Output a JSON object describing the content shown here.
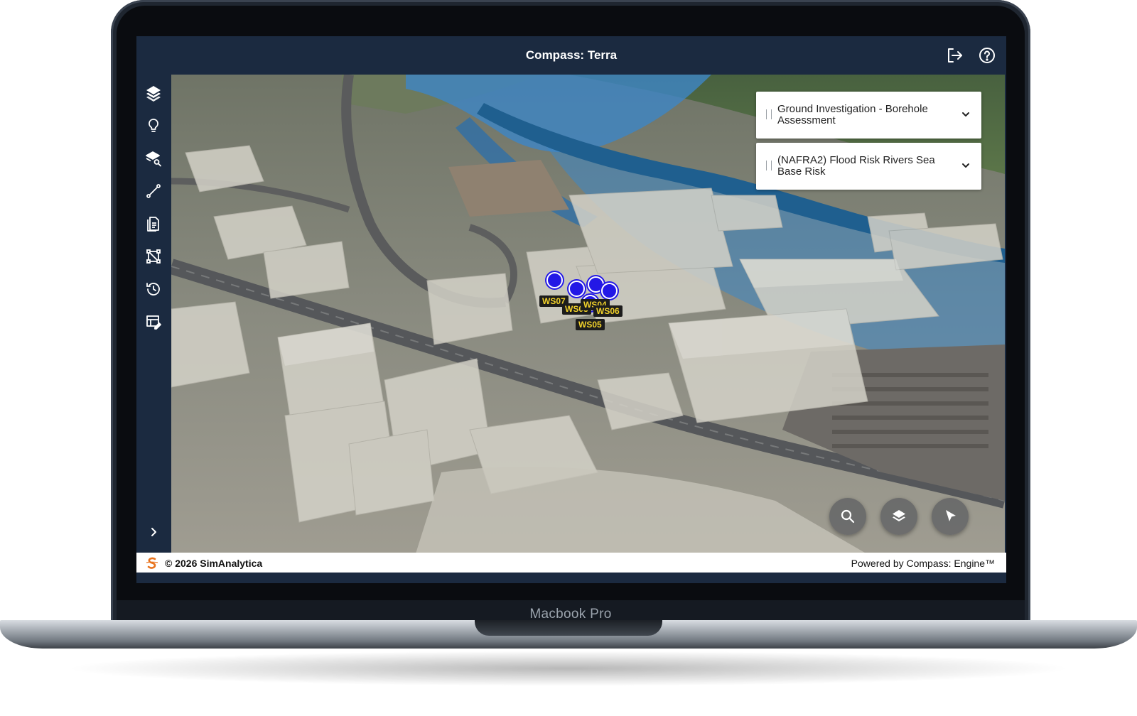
{
  "app": {
    "title": "Compass: Terra",
    "header_icons": [
      "logout-icon",
      "help-icon"
    ]
  },
  "sidebar": {
    "items": [
      {
        "name": "layers",
        "icon": "layers-icon"
      },
      {
        "name": "insights",
        "icon": "lightbulb-icon"
      },
      {
        "name": "layer-search",
        "icon": "layer-search-icon"
      },
      {
        "name": "measure",
        "icon": "measure-line-icon"
      },
      {
        "name": "reports",
        "icon": "document-icon"
      },
      {
        "name": "network",
        "icon": "network-icon"
      },
      {
        "name": "history",
        "icon": "history-icon"
      },
      {
        "name": "form-edit",
        "icon": "form-edit-icon"
      }
    ],
    "expand_icon": "chevron-right-icon"
  },
  "layer_panels": [
    {
      "label": "Ground Investigation - Borehole Assessment"
    },
    {
      "label": "(NAFRA2) Flood Risk Rivers Sea Base Risk"
    }
  ],
  "boreholes": [
    "WS07",
    "WS03",
    "WS04",
    "WS06",
    "WS05"
  ],
  "map_controls": [
    "search-icon",
    "layers-icon",
    "select-arrow-icon"
  ],
  "colors": {
    "header_bg": "#1b2a40",
    "marker": "#2318e6",
    "label_text": "#f2d22b",
    "flood": "#3d86c6"
  },
  "footer": {
    "copyright": "© 2026 SimAnalytica",
    "powered_by": "Powered by Compass: Engine™"
  },
  "device": {
    "label": "Macbook Pro"
  }
}
